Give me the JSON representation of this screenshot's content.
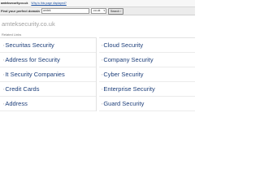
{
  "topbar": {
    "domain": "amteksecurity.co.uk",
    "why_link": "Why is this page displayed?"
  },
  "search": {
    "label": "Find your perfect domain",
    "value": "amtek",
    "tld": ".co.uk",
    "button": "Search"
  },
  "main": {
    "title": "amteksecurity.co.uk",
    "related_label": "Related Links",
    "left_links": [
      "Securitas Security",
      "Address for Security",
      "It Security Companies",
      "Credit Cards",
      "Address"
    ],
    "right_links": [
      "Cloud Security",
      "Company Security",
      "Cyber Security",
      "Enterprise Security",
      "Guard Security"
    ]
  },
  "colors": {
    "link": "#1e3f7a",
    "title": "#a0a0a0"
  }
}
